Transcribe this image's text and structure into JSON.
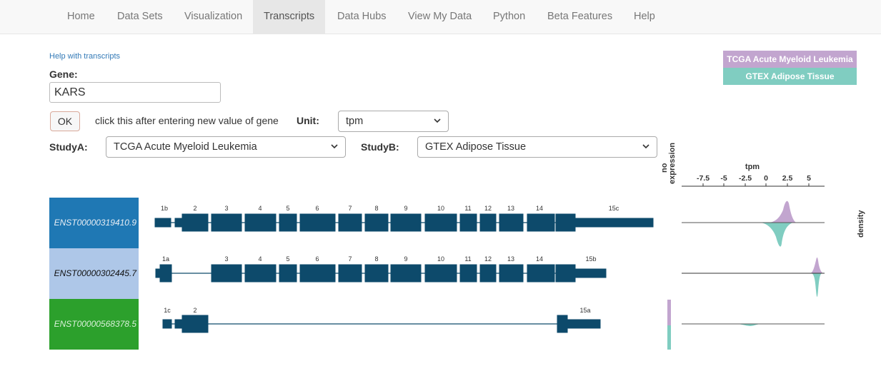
{
  "nav": {
    "items": [
      "Home",
      "Data Sets",
      "Visualization",
      "Transcripts",
      "Data Hubs",
      "View My Data",
      "Python",
      "Beta Features",
      "Help"
    ],
    "active": "Transcripts"
  },
  "form": {
    "help_link": "Help with transcripts",
    "gene_label": "Gene:",
    "gene_value": "KARS",
    "ok_label": "OK",
    "hint": "click this after entering new value of gene",
    "unit_label": "Unit:",
    "unit_value": "tpm",
    "studyA_label": "StudyA:",
    "studyA_value": "TCGA Acute Myeloid Leukemia",
    "studyB_label": "StudyB:",
    "studyB_value": "GTEX Adipose Tissue"
  },
  "legend": {
    "studyA": "TCGA Acute Myeloid Leukemia",
    "studyB": "GTEX Adipose Tissue",
    "studyA_color": "#c2a5cf",
    "studyB_color": "#80cdc1"
  },
  "axis": {
    "no_expression_line1": "no",
    "no_expression_line2": "expression",
    "unit_title": "tpm",
    "ticks": [
      "-7.5",
      "-5",
      "-2.5",
      "0",
      "2.5",
      "5"
    ],
    "density_label": "density"
  },
  "colors": {
    "exon": "#0d4a6b",
    "tx1_bg": "#1f78b4",
    "tx2_bg": "#aec7e8",
    "tx3_bg": "#2ca02c"
  },
  "transcripts": [
    {
      "id": "ENST00000319410.9",
      "exon_labels": [
        "1b",
        "2",
        "3",
        "4",
        "5",
        "6",
        "7",
        "8",
        "9",
        "10",
        "11",
        "12",
        "13",
        "14",
        "15c"
      ]
    },
    {
      "id": "ENST00000302445.7",
      "exon_labels": [
        "1a",
        "3",
        "4",
        "5",
        "6",
        "7",
        "8",
        "9",
        "10",
        "11",
        "12",
        "13",
        "14",
        "15b"
      ]
    },
    {
      "id": "ENST00000568378.5",
      "exon_labels": [
        "1c",
        "2",
        "15a"
      ]
    }
  ]
}
